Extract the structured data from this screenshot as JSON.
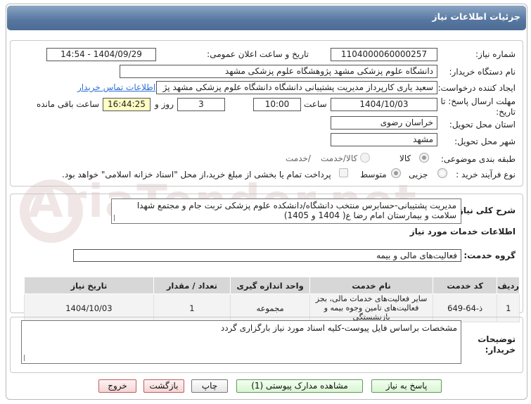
{
  "header": {
    "title": "جزئیات اطلاعات نیاز"
  },
  "fields": {
    "need_number_label": "شماره نیاز:",
    "need_number": "1104000060000257",
    "announce_label": "تاریخ و ساعت اعلان عمومی:",
    "announce_value": "1404/09/29 - 14:54",
    "buyer_org_label": "نام دستگاه خریدار:",
    "buyer_org": "دانشگاه علوم پزشکی مشهد   پژوهشگاه علوم پزشکی مشهد",
    "creator_label": "ایجاد کننده درخواست:",
    "creator": "سعید یاری کارپرداز مدیریت پشتیبانی دانشگاه دانشگاه علوم پزشکی مشهد   پژ",
    "contact_link": "اطلاعات تماس خریدار",
    "deadline_label_line1": "مهلت ارسال پاسخ: تا",
    "deadline_label_line2": "تاریخ:",
    "deadline_date": "1404/10/03",
    "time_label": "ساعت",
    "deadline_time": "10:00",
    "days_value": "3",
    "days_label": "روز و",
    "remaining_time": "16:44:25",
    "remaining_label": "ساعت باقی مانده",
    "province_label": "استان محل تحویل:",
    "province": "خراسان رضوی",
    "city_label": "شهر محل تحویل:",
    "city": "مشهد",
    "category_label": "طبقه بندی موضوعی:",
    "category_options": [
      "کالا",
      "کالا/خدمت"
    ],
    "process_label": "نوع فرآیند خرید :",
    "process_options": [
      "جزیی",
      "متوسط"
    ],
    "payment_note": "پرداخت تمام یا بخشی از مبلغ خرید،از محل \"اسناد خزانه اسلامی\" خواهد بود."
  },
  "summary": {
    "label": "شرح کلی نیاز:",
    "text": "مدیریت پشتیبانی-حسابرس منتخب دانشگاه/دانشکده علوم پزشکی تربت جام و مجتمع شهدا سلامت و بیمارستان امام رضا ع( 1404 و 1405)"
  },
  "services": {
    "section_title": "اطلاعات خدمات مورد نیاز",
    "group_label": "گروه خدمت:",
    "group_value": "فعالیت‌های مالی و بیمه",
    "columns": [
      "ردیف",
      "کد خدمت",
      "نام خدمت",
      "واحد اندازه گیری",
      "تعداد / مقدار",
      "تاریخ نیاز"
    ],
    "rows": [
      [
        "1",
        "ذ-64-649",
        "سایر فعالیت‌های خدمات مالی، بجز فعالیت‌های تامین وجوه بیمه و بازنشستگی",
        "مجموعه",
        "1",
        "1404/10/03"
      ]
    ]
  },
  "buyer_notes": {
    "label_line1": "توضیحات",
    "label_line2": "خریدار:",
    "text": "مشخصات براساس فایل پیوست-کلیه اسناد مورد نیاز بارگزاری گردد"
  },
  "buttons": {
    "reply": "پاسخ به نیاز",
    "view_docs": "مشاهده مدارک پیوستی (1)",
    "print": "چاپ",
    "back": "بازگشت",
    "exit": "خروج"
  },
  "watermark": "AriaTender.net"
}
